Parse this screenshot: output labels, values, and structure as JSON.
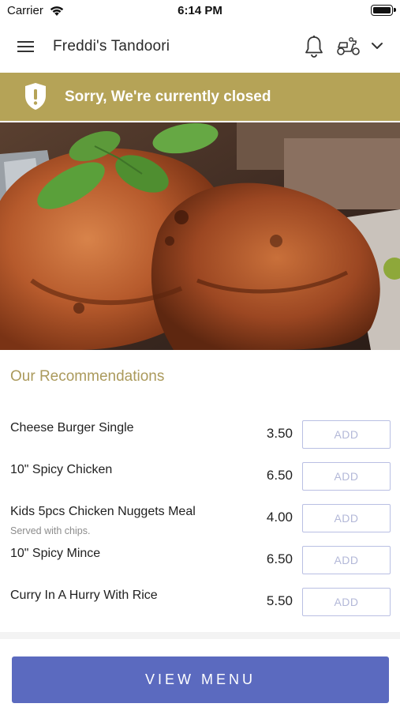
{
  "status_bar": {
    "carrier": "Carrier",
    "time": "6:14 PM"
  },
  "header": {
    "title": "Freddi's Tandoori",
    "icons": [
      "menu-icon",
      "bell-icon",
      "delivery-scooter-icon",
      "chevron-down-icon"
    ]
  },
  "banner": {
    "text": "Sorry, We're currently closed",
    "icon": "shield-exclamation-icon",
    "color": "#b5a357"
  },
  "hero": {
    "icon": "tandoori-chicken-image"
  },
  "recommendations": {
    "title": "Our Recommendations",
    "items": [
      {
        "name": "Cheese Burger Single",
        "description": "",
        "price": "3.50",
        "button": "ADD"
      },
      {
        "name": "10\" Spicy Chicken",
        "description": "",
        "price": "6.50",
        "button": "ADD"
      },
      {
        "name": "Kids 5pcs Chicken Nuggets Meal",
        "description": "Served with chips.",
        "price": "4.00",
        "button": "ADD"
      },
      {
        "name": "10\" Spicy Mince",
        "description": "",
        "price": "6.50",
        "button": "ADD"
      },
      {
        "name": "Curry In A Hurry With Rice",
        "description": "",
        "price": "5.50",
        "button": "ADD"
      }
    ]
  },
  "footer": {
    "button": "VIEW MENU",
    "accent": "#5b6abf"
  }
}
